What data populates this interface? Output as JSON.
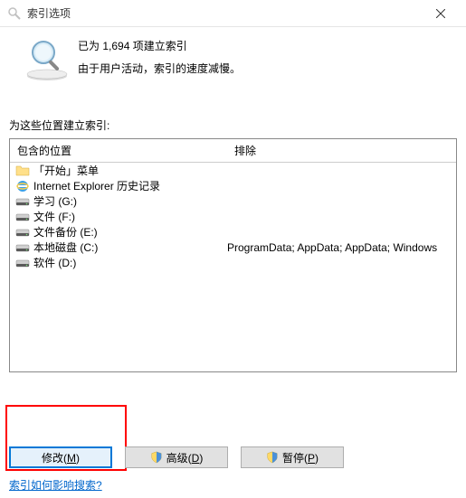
{
  "titlebar": {
    "title": "索引选项"
  },
  "info": {
    "status": "已为 1,694 项建立索引",
    "notice": "由于用户活动，索引的速度减慢。"
  },
  "section_label": "为这些位置建立索引:",
  "list": {
    "header_included": "包含的位置",
    "header_excluded": "排除",
    "items": [
      {
        "icon": "folder",
        "label": "「开始」菜单",
        "excluded": ""
      },
      {
        "icon": "ie",
        "label": "Internet Explorer 历史记录",
        "excluded": ""
      },
      {
        "icon": "drive",
        "label": "学习 (G:)",
        "excluded": ""
      },
      {
        "icon": "drive",
        "label": "文件 (F:)",
        "excluded": ""
      },
      {
        "icon": "drive",
        "label": "文件备份 (E:)",
        "excluded": ""
      },
      {
        "icon": "drive",
        "label": "本地磁盘 (C:)",
        "excluded": "ProgramData; AppData; AppData; Windows"
      },
      {
        "icon": "drive",
        "label": "软件 (D:)",
        "excluded": ""
      }
    ]
  },
  "buttons": {
    "modify": "修改",
    "modify_key": "M",
    "advanced": "高级",
    "advanced_key": "D",
    "pause": "暂停",
    "pause_key": "P"
  },
  "link": "索引如何影响搜索?"
}
